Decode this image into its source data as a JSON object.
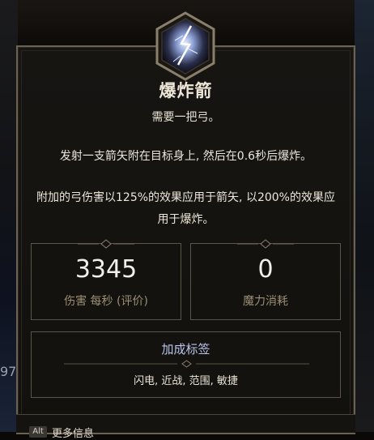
{
  "skill": {
    "name": "爆炸箭",
    "requirement": "需要一把弓。",
    "description_1": "发射一支箭矢附在目标身上, 然后在0.6秒后爆炸。",
    "description_2": "附加的弓伤害以125%的效果应用于箭矢, 以200%的效果应用于爆炸。",
    "icon": "lightning-bolt-icon"
  },
  "stats": {
    "dps_value": "3345",
    "dps_label": "伤害 每秒 (评价)",
    "mana_value": "0",
    "mana_label": "魔力消耗"
  },
  "tags": {
    "title": "加成标签",
    "list": "闪电, 近战, 范围, 敏捷"
  },
  "footer": {
    "key_hint": "Alt",
    "more_info": "更多信息"
  },
  "background": {
    "side_number": "97"
  },
  "colors": {
    "border": "#6b6253",
    "panel": "#14120f",
    "tag_title": "#b9c6ec",
    "label": "#9b8e74"
  }
}
